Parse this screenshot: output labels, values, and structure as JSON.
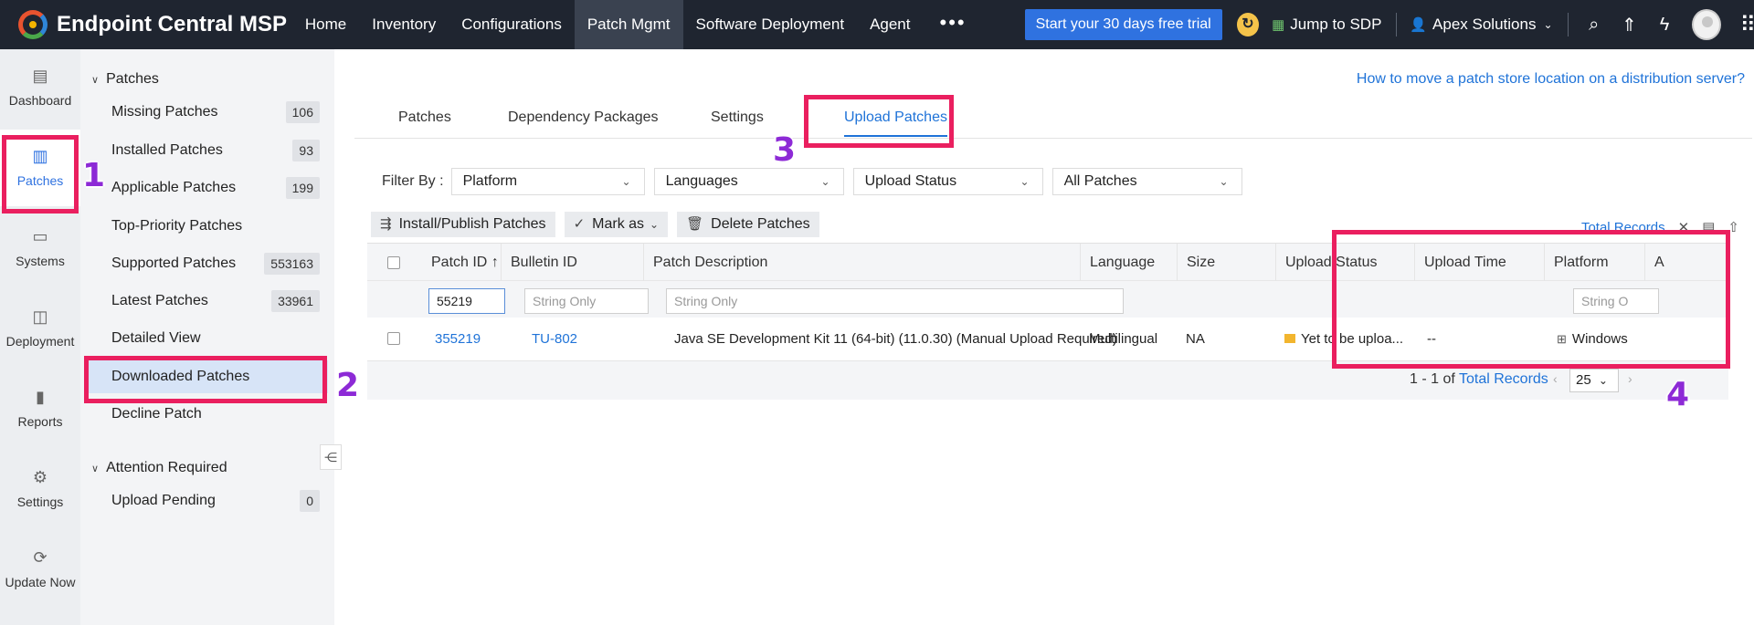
{
  "topbar": {
    "app_title": "Endpoint Central MSP",
    "nav": [
      "Home",
      "Inventory",
      "Configurations",
      "Patch Mgmt",
      "Software Deployment",
      "Agent"
    ],
    "more": "•••",
    "trial_button": "Start your 30 days free trial",
    "jump_label": "Jump to SDP",
    "account_name": "Apex Solutions"
  },
  "leftrail": {
    "items": [
      "Dashboard",
      "Patches",
      "Systems",
      "Deployment",
      "Reports",
      "Settings",
      "Update Now"
    ]
  },
  "sidebar": {
    "section1": "Patches",
    "items": [
      {
        "label": "Missing Patches",
        "count": "106"
      },
      {
        "label": "Installed Patches",
        "count": "93"
      },
      {
        "label": "Applicable Patches",
        "count": "199"
      },
      {
        "label": "Top-Priority Patches",
        "count": ""
      },
      {
        "label": "Supported Patches",
        "count": "553163"
      },
      {
        "label": "Latest Patches",
        "count": "33961"
      },
      {
        "label": "Detailed View",
        "count": ""
      },
      {
        "label": "Downloaded Patches",
        "count": ""
      },
      {
        "label": "Decline Patch",
        "count": ""
      }
    ],
    "section2": "Attention Required",
    "section2_items": [
      {
        "label": "Upload Pending",
        "count": "0"
      }
    ]
  },
  "main": {
    "help_link": "How to move a patch store location on a distribution server?",
    "tabs": [
      "Patches",
      "Dependency Packages",
      "Settings",
      "Upload Patches"
    ],
    "filter_label": "Filter By :",
    "filters": [
      "Platform",
      "Languages",
      "Upload Status",
      "All Patches"
    ],
    "actions": [
      "Install/Publish Patches",
      "Mark as",
      "Delete Patches"
    ],
    "total_records_link": "Total Records",
    "table": {
      "headers": [
        "Patch ID",
        "Bulletin ID",
        "Patch Description",
        "Language",
        "Size",
        "Upload Status",
        "Upload Time",
        "Platform",
        "A"
      ],
      "filter_inputs": {
        "patch_id": "55219",
        "bulletin_id": "String Only",
        "description": "String Only",
        "platform": "String O"
      },
      "row": {
        "patch_id": "355219",
        "bulletin_id": "TU-802",
        "description": "Java SE Development Kit 11 (64-bit) (11.0.30) (Manual Upload Required)",
        "language": "Multilingual",
        "size": "NA",
        "upload_status": "Yet to be uploa...",
        "upload_time": "--",
        "platform": "Windows"
      },
      "pager_text": "1 - 1 of",
      "pager_link": "Total Records",
      "page_size": "25"
    }
  },
  "annotations": [
    "1",
    "2",
    "3",
    "4"
  ],
  "colors": {
    "accent": "#1f73d8",
    "annotation_box": "#ea1f5f",
    "annotation_number": "#8d2ad6",
    "topbar": "#1f2530"
  }
}
